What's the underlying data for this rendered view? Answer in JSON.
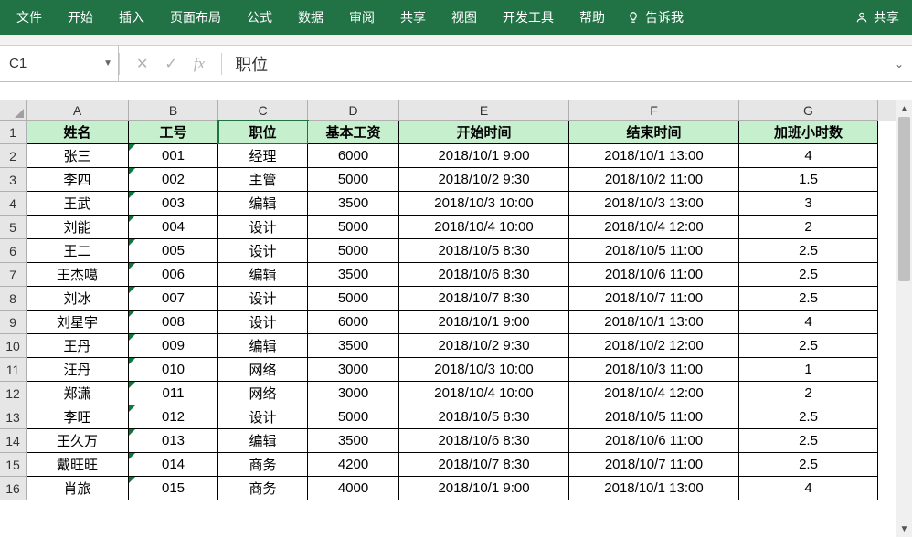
{
  "ribbon": {
    "tabs": [
      "文件",
      "开始",
      "插入",
      "页面布局",
      "公式",
      "数据",
      "审阅",
      "共享",
      "视图",
      "开发工具",
      "帮助"
    ],
    "tell_me": "告诉我",
    "share": "共享"
  },
  "formula_bar": {
    "name_box": "C1",
    "cancel_glyph": "✕",
    "enter_glyph": "✓",
    "fx_label": "fx",
    "value": "职位"
  },
  "columns": [
    "A",
    "B",
    "C",
    "D",
    "E",
    "F",
    "G"
  ],
  "col_widths": [
    "wA",
    "wB",
    "wC",
    "wD",
    "wE",
    "wF",
    "wG"
  ],
  "row_numbers": [
    1,
    2,
    3,
    4,
    5,
    6,
    7,
    8,
    9,
    10,
    11,
    12,
    13,
    14,
    15,
    16
  ],
  "header_row": [
    "姓名",
    "工号",
    "职位",
    "基本工资",
    "开始时间",
    "结束时间",
    "加班小时数"
  ],
  "data_rows": [
    [
      "张三",
      "001",
      "经理",
      "6000",
      "2018/10/1 9:00",
      "2018/10/1 13:00",
      "4"
    ],
    [
      "李四",
      "002",
      "主管",
      "5000",
      "2018/10/2 9:30",
      "2018/10/2 11:00",
      "1.5"
    ],
    [
      "王武",
      "003",
      "编辑",
      "3500",
      "2018/10/3 10:00",
      "2018/10/3 13:00",
      "3"
    ],
    [
      "刘能",
      "004",
      "设计",
      "5000",
      "2018/10/4 10:00",
      "2018/10/4 12:00",
      "2"
    ],
    [
      "王二",
      "005",
      "设计",
      "5000",
      "2018/10/5 8:30",
      "2018/10/5 11:00",
      "2.5"
    ],
    [
      "王杰噶",
      "006",
      "编辑",
      "3500",
      "2018/10/6 8:30",
      "2018/10/6 11:00",
      "2.5"
    ],
    [
      "刘冰",
      "007",
      "设计",
      "5000",
      "2018/10/7 8:30",
      "2018/10/7 11:00",
      "2.5"
    ],
    [
      "刘星宇",
      "008",
      "设计",
      "6000",
      "2018/10/1 9:00",
      "2018/10/1 13:00",
      "4"
    ],
    [
      "王丹",
      "009",
      "编辑",
      "3500",
      "2018/10/2 9:30",
      "2018/10/2 12:00",
      "2.5"
    ],
    [
      "汪丹",
      "010",
      "网络",
      "3000",
      "2018/10/3 10:00",
      "2018/10/3 11:00",
      "1"
    ],
    [
      "郑潇",
      "011",
      "网络",
      "3000",
      "2018/10/4 10:00",
      "2018/10/4 12:00",
      "2"
    ],
    [
      "李旺",
      "012",
      "设计",
      "5000",
      "2018/10/5 8:30",
      "2018/10/5 11:00",
      "2.5"
    ],
    [
      "王久万",
      "013",
      "编辑",
      "3500",
      "2018/10/6 8:30",
      "2018/10/6 11:00",
      "2.5"
    ],
    [
      "戴旺旺",
      "014",
      "商务",
      "4200",
      "2018/10/7 8:30",
      "2018/10/7 11:00",
      "2.5"
    ],
    [
      "肖旅",
      "015",
      "商务",
      "4000",
      "2018/10/1 9:00",
      "2018/10/1 13:00",
      "4"
    ]
  ],
  "selected_cell": {
    "row": 0,
    "col": 2
  }
}
